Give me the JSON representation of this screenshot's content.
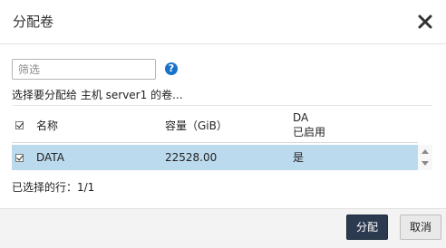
{
  "dialog": {
    "title": "分配卷",
    "filter_placeholder": "筛选",
    "help_icon_glyph": "?",
    "instruction": "选择要分配给 主机 server1 的卷...",
    "table": {
      "columns": {
        "name": "名称",
        "capacity": "容量（GiB）",
        "da_line1": "DA",
        "da_line2": "已启用"
      },
      "rows": [
        {
          "checked": true,
          "name": "DATA",
          "capacity": "22528.00",
          "da": "是"
        }
      ],
      "selected_row_color": "#bcdaee"
    },
    "selected_rows_text": "已选择的行：1/1",
    "buttons": {
      "assign": "分配",
      "cancel": "取消"
    },
    "icons": {
      "close": "close-icon",
      "help": "help-icon",
      "scroll_up": "triangle-up-icon",
      "scroll_down": "triangle-down-icon"
    },
    "colors": {
      "primary_button": "#2b3a4f",
      "help_icon": "#1a73c9"
    }
  }
}
